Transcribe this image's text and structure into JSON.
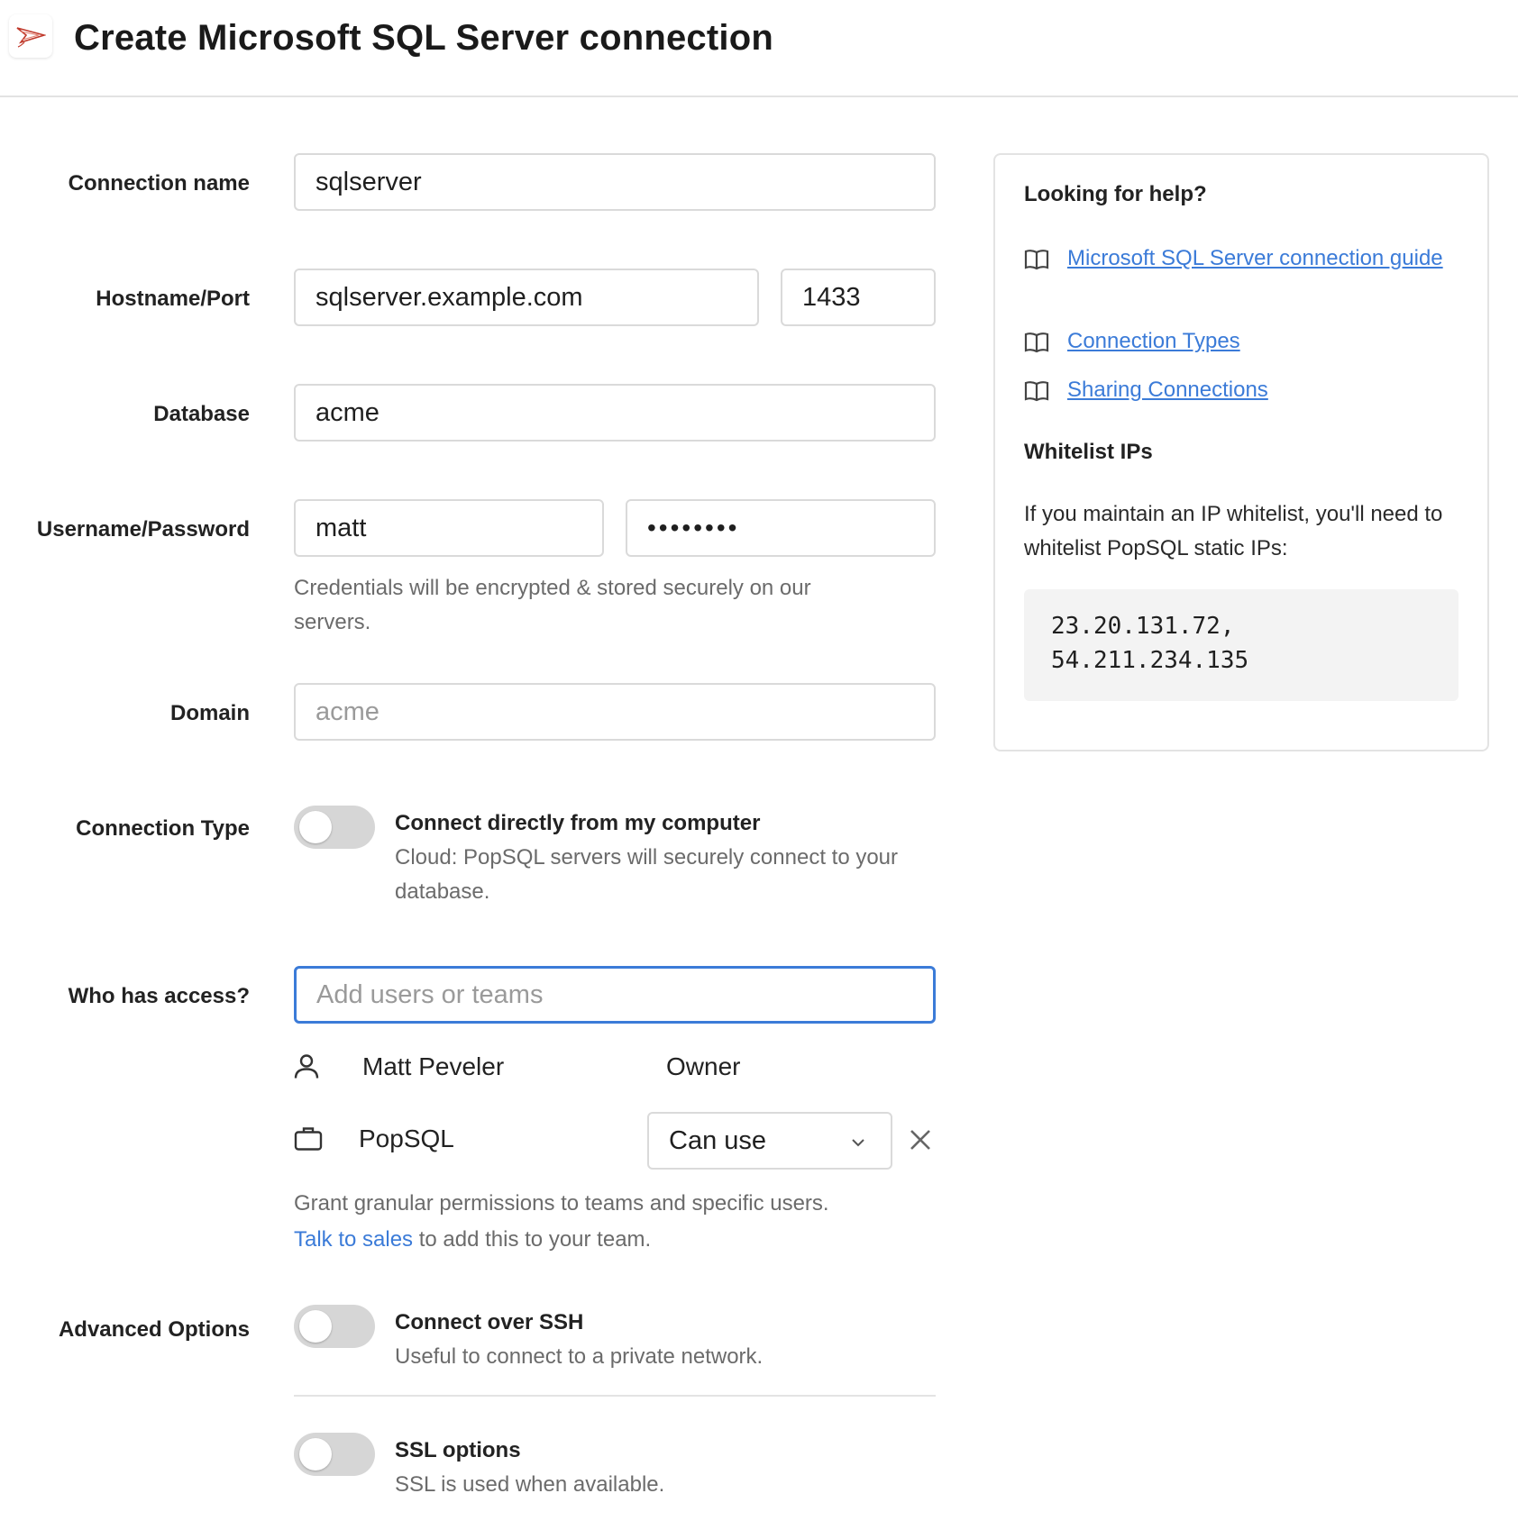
{
  "header": {
    "title": "Create Microsoft SQL Server connection",
    "logo_icon": "sql-server-logo"
  },
  "form": {
    "connection_name": {
      "label": "Connection name",
      "value": "sqlserver"
    },
    "hostname_port": {
      "label": "Hostname/Port",
      "hostname": "sqlserver.example.com",
      "port": "1433"
    },
    "database": {
      "label": "Database",
      "value": "acme"
    },
    "username_password": {
      "label": "Username/Password",
      "username": "matt",
      "password": "••••••••",
      "hint": "Credentials will be encrypted & stored securely on our servers."
    },
    "domain": {
      "label": "Domain",
      "placeholder": "acme"
    },
    "connection_type": {
      "label": "Connection Type",
      "toggle_on": false,
      "title": "Connect directly from my computer",
      "desc": "Cloud: PopSQL servers will securely connect to your database."
    },
    "access": {
      "label": "Who has access?",
      "placeholder": "Add users or teams",
      "entries": [
        {
          "icon": "user-icon",
          "name": "Matt Peveler",
          "role": "Owner"
        },
        {
          "icon": "briefcase-icon",
          "name": "PopSQL",
          "permission": "Can use",
          "permission_icon": "chevron-down-icon",
          "remove_icon": "close-icon"
        }
      ],
      "hint_text": "Grant granular permissions to teams and specific users.",
      "sales_link": "Talk to sales",
      "hint_suffix": " to add this to your team."
    },
    "advanced": {
      "label": "Advanced Options",
      "ssh": {
        "title": "Connect over SSH",
        "desc": "Useful to connect to a private network.",
        "toggle_on": false
      },
      "ssl": {
        "title": "SSL options",
        "desc": "SSL is used when available.",
        "toggle_on": false
      }
    }
  },
  "help": {
    "title": "Looking for help?",
    "links": [
      {
        "icon": "book-icon",
        "label": "Microsoft SQL Server connection guide"
      },
      {
        "icon": "book-icon",
        "label": "Connection Types"
      },
      {
        "icon": "book-icon",
        "label": "Sharing Connections"
      }
    ],
    "whitelist_title": "Whitelist IPs",
    "whitelist_desc": "If you maintain an IP whitelist, you'll need to whitelist PopSQL static IPs:",
    "ips": [
      "23.20.131.72,",
      "54.211.234.135"
    ]
  },
  "colors": {
    "accent": "#3b7bd8",
    "toggle_off": "#d6d6d6",
    "border": "#dadada"
  }
}
